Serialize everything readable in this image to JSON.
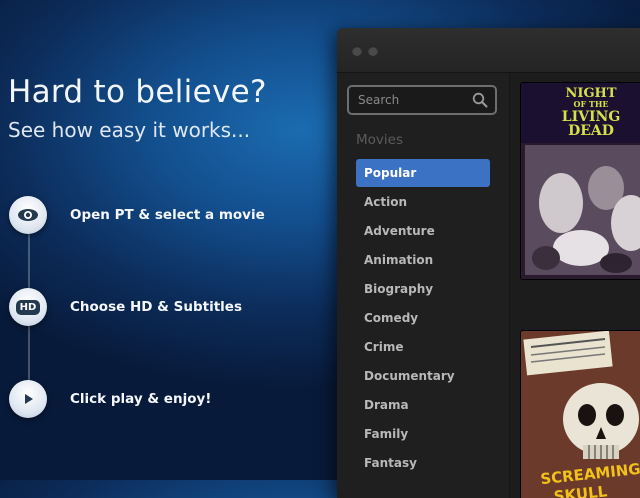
{
  "hero": {
    "title": "Hard to believe?",
    "subtitle": "See how easy it works...",
    "steps": [
      {
        "icon": "eye-icon",
        "label": "Open PT & select a movie"
      },
      {
        "icon": "hd-icon",
        "icon_text": "HD",
        "label": "Choose HD & Subtitles"
      },
      {
        "icon": "play-icon",
        "label": "Click play & enjoy!"
      }
    ]
  },
  "app": {
    "search": {
      "placeholder": "Search",
      "icon": "search-icon"
    },
    "section_title": "Movies",
    "categories": [
      "Popular",
      "Action",
      "Adventure",
      "Animation",
      "Biography",
      "Comedy",
      "Crime",
      "Documentary",
      "Drama",
      "Family",
      "Fantasy"
    ],
    "active_category": "Popular",
    "posters": [
      {
        "title_lines": [
          "NIGHT",
          "OF THE",
          "LIVING",
          "DEAD"
        ]
      },
      {
        "title_lines": [
          "SCREAMING",
          "SKULL"
        ]
      }
    ]
  },
  "colors": {
    "accent": "#3b72c4",
    "background": "#0c2c5a",
    "sidebar": "#1f1f1f"
  }
}
